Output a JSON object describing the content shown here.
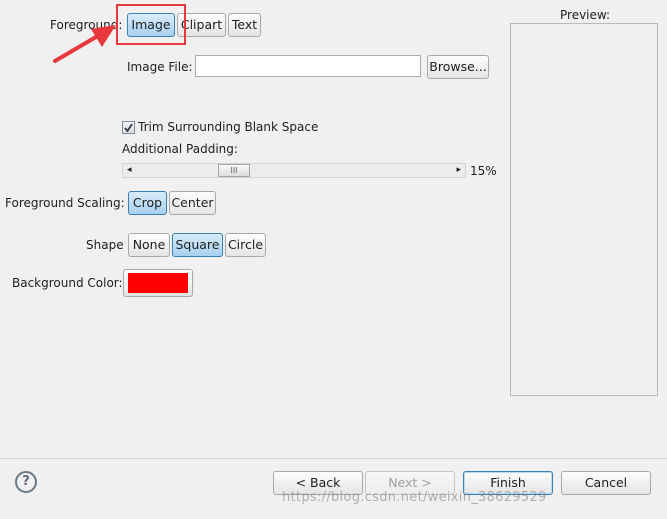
{
  "foreground": {
    "label": "Foreground:",
    "options": [
      "Image",
      "Clipart",
      "Text"
    ],
    "selected": "Image"
  },
  "image_file": {
    "label": "Image File:",
    "value": "",
    "browse_label": "Browse..."
  },
  "trim": {
    "label": "Trim Surrounding Blank Space",
    "checked": true
  },
  "padding": {
    "label": "Additional Padding:",
    "value_text": "15%",
    "value_fraction": 0.15
  },
  "scaling": {
    "label": "Foreground Scaling:",
    "options": [
      "Crop",
      "Center"
    ],
    "selected": "Crop"
  },
  "shape": {
    "label": "Shape",
    "options": [
      "None",
      "Square",
      "Circle"
    ],
    "selected": "Square"
  },
  "background": {
    "label": "Background Color:",
    "color": "#ff0000"
  },
  "preview": {
    "label": "Preview:"
  },
  "footer": {
    "help_icon": "question-circle-icon",
    "back_label": "< Back",
    "next_label": "Next >",
    "finish_label": "Finish",
    "cancel_label": "Cancel"
  },
  "watermark": "https://blog.csdn.net/weixin_38629529",
  "annotation_color": "#e8383d"
}
